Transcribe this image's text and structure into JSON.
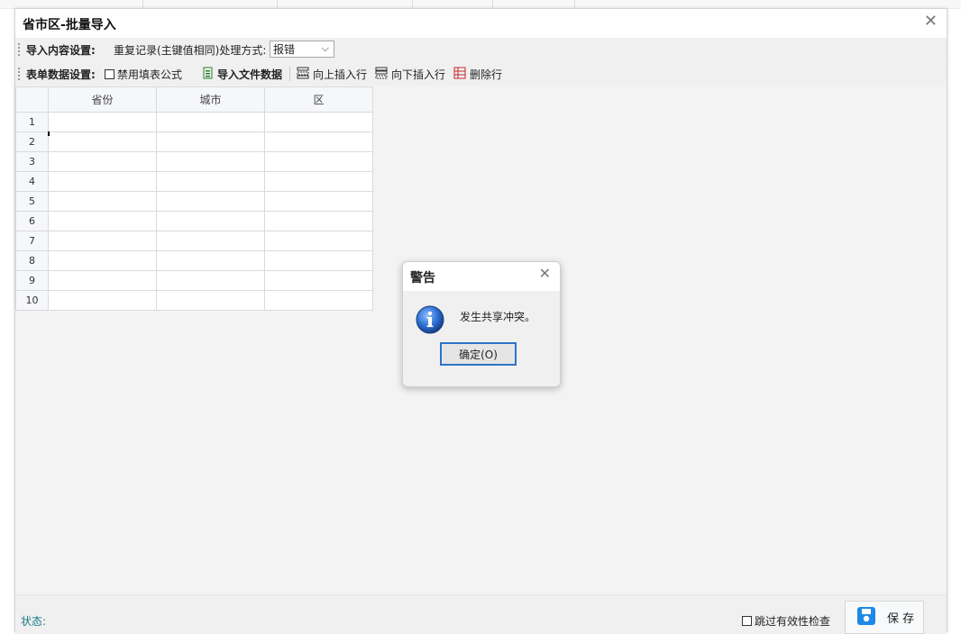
{
  "window": {
    "title": "省市区-批量导入",
    "close_glyph": "✕"
  },
  "toolbar1": {
    "section_label": "导入内容设置:",
    "duplicate_label": "重复记录(主键值相同)处理方式:",
    "duplicate_select_value": "报错"
  },
  "toolbar2": {
    "section_label": "表单数据设置:",
    "disable_formula_label": "禁用填表公式",
    "import_file_label": "导入文件数据",
    "insert_above_label": "向上插入行",
    "insert_below_label": "向下插入行",
    "delete_row_label": "删除行"
  },
  "grid": {
    "columns": [
      "省份",
      "城市",
      "区"
    ],
    "row_numbers": [
      "1",
      "2",
      "3",
      "4",
      "5",
      "6",
      "7",
      "8",
      "9",
      "10"
    ]
  },
  "statusbar": {
    "status_label": "状态:",
    "skip_validation_label": "跳过有效性检查",
    "save_label": "保 存"
  },
  "dialog": {
    "title": "警告",
    "message": "发生共享冲突。",
    "ok_label": "确定(O)",
    "close_glyph": "✕"
  },
  "colors": {
    "accent_blue": "#2b74c7",
    "status_teal": "#1a7a8a",
    "save_icon_blue": "#1e88e5"
  },
  "icons": [
    "info-icon",
    "save-icon",
    "import-file-icon",
    "insert-above-icon",
    "insert-below-icon",
    "delete-row-icon",
    "close-icon"
  ]
}
